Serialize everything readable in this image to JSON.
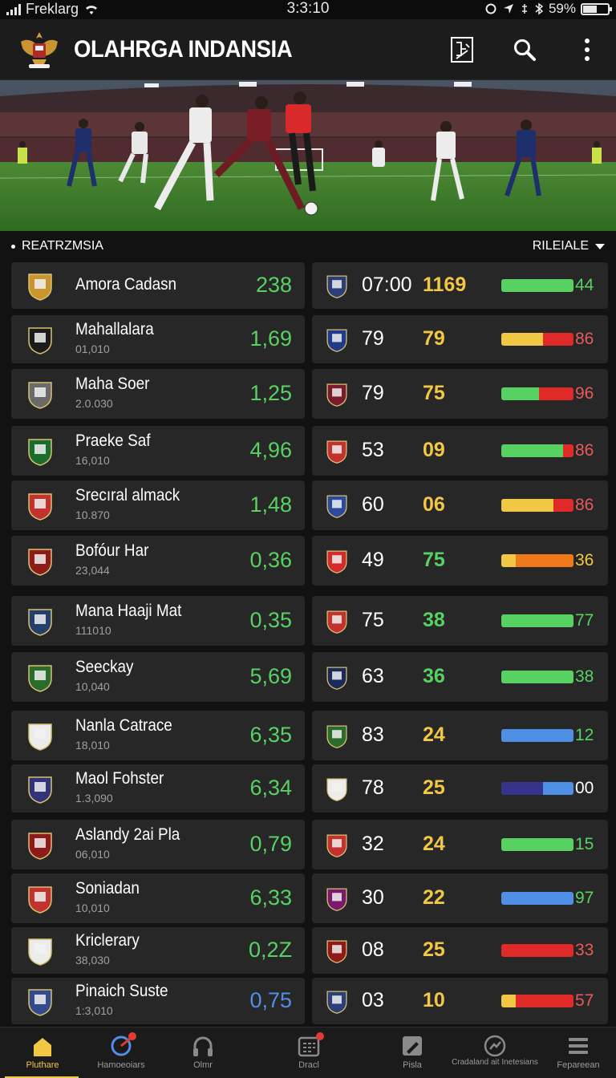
{
  "status_bar": {
    "carrier": "Freklarg",
    "time": "3:3:10",
    "battery": "59%"
  },
  "app_bar": {
    "title": "OLAHRGA INDANSIA"
  },
  "section": {
    "left_label": "REATRZMSIA",
    "right_label": "RILEIALE"
  },
  "colors": {
    "green": "#58d163",
    "yellow": "#f2c744",
    "red": "#e02a2a",
    "blue": "#4f8fe6",
    "orange": "#f07a1a",
    "navy": "#35348a"
  },
  "rows": [
    {
      "name": "Amora Cadasn",
      "sub": "",
      "odds": "238",
      "n1": "07:00",
      "n2": "1169",
      "n2_color": "yellow",
      "bar_val": "44",
      "bar": [
        [
          "green",
          1.0
        ]
      ]
    },
    {
      "name": "Mahallalara",
      "sub": "01,010",
      "odds": "1,69",
      "n1": "79",
      "n2": "79",
      "n2_color": "yellow",
      "bar_val": "86",
      "bar": [
        [
          "yellow",
          0.58
        ],
        [
          "red",
          0.42
        ]
      ]
    },
    {
      "name": "Maha Soer",
      "sub": "2.0.030",
      "odds": "1,25",
      "n1": "79",
      "n2": "75",
      "n2_color": "yellow",
      "bar_val": "96",
      "bar": [
        [
          "green",
          0.52
        ],
        [
          "red",
          0.48
        ]
      ]
    },
    {
      "name": "Praeke Saf",
      "sub": "16,010",
      "odds": "4,96",
      "n1": "53",
      "n2": "09",
      "n2_color": "yellow",
      "bar_val": "86",
      "bar": [
        [
          "green",
          0.86
        ],
        [
          "red",
          0.14
        ]
      ]
    },
    {
      "name": "Srecıral almack",
      "sub": "10.870",
      "odds": "1,48",
      "n1": "60",
      "n2": "06",
      "n2_color": "yellow",
      "bar_val": "86",
      "bar": [
        [
          "yellow",
          0.72
        ],
        [
          "red",
          0.28
        ]
      ]
    },
    {
      "name": "Bofóur Har",
      "sub": "23,044",
      "odds": "0,36",
      "n1": "49",
      "n2": "75",
      "n2_color": "green",
      "bar_val": "36",
      "bar": [
        [
          "yellow",
          0.2
        ],
        [
          "orange",
          0.8
        ]
      ]
    },
    {
      "name": "Mana Haaji Mat",
      "sub": "111010",
      "odds": "0,35",
      "n1": "75",
      "n2": "38",
      "n2_color": "green",
      "bar_val": "77",
      "bar": [
        [
          "green",
          1.0
        ]
      ]
    },
    {
      "name": "Seeckay",
      "sub": "10,040",
      "odds": "5,69",
      "n1": "63",
      "n2": "36",
      "n2_color": "green",
      "bar_val": "38",
      "bar": [
        [
          "green",
          1.0
        ]
      ]
    },
    {
      "name": "Nanla Catrace",
      "sub": "18,010",
      "odds": "6,35",
      "n1": "83",
      "n2": "24",
      "n2_color": "yellow",
      "bar_val": "12",
      "bar": [
        [
          "blue",
          1.0
        ]
      ]
    },
    {
      "name": "Maol Fohster",
      "sub": "1.3,090",
      "odds": "6,34",
      "n1": "78",
      "n2": "25",
      "n2_color": "yellow",
      "bar_val": "00",
      "bar": [
        [
          "navy",
          0.58
        ],
        [
          "blue",
          0.42
        ]
      ]
    },
    {
      "name": "Aslandy 2ai Pla",
      "sub": "06,010",
      "odds": "0,79",
      "n1": "32",
      "n2": "24",
      "n2_color": "yellow",
      "bar_val": "15",
      "bar": [
        [
          "green",
          1.0
        ]
      ]
    },
    {
      "name": "Soniadan",
      "sub": "10,010",
      "odds": "6,33",
      "n1": "30",
      "n2": "22",
      "n2_color": "yellow",
      "bar_val": "97",
      "bar": [
        [
          "blue",
          1.0
        ]
      ]
    },
    {
      "name": "Kriclerary",
      "sub": "38,030",
      "odds": "0,2Z",
      "n1": "08",
      "n2": "25",
      "n2_color": "yellow",
      "bar_val": "33",
      "bar": [
        [
          "red",
          1.0
        ]
      ]
    },
    {
      "name": "Pinaich Suste",
      "sub": "1:3,010",
      "odds": "0,75",
      "odds_color": "blue",
      "n1": "03",
      "n2": "10",
      "n2_color": "yellow",
      "bar_val": "57",
      "bar": [
        [
          "yellow",
          0.2
        ],
        [
          "red",
          0.8
        ]
      ]
    }
  ],
  "bottom_nav": [
    {
      "label": "Pluthare",
      "icon": "home-icon",
      "active": true
    },
    {
      "label": "Hamoeoiars",
      "icon": "target-icon",
      "badge": true
    },
    {
      "label": "Olmr",
      "icon": "headphones-icon"
    },
    {
      "label": "Dracl",
      "icon": "calendar-icon",
      "badge": true
    },
    {
      "label": "Pisla",
      "icon": "pencil-icon"
    },
    {
      "label": "Cradaland ait Inetesians",
      "icon": "gauge-icon"
    },
    {
      "label": "Fepareean",
      "icon": "menu-icon"
    }
  ]
}
